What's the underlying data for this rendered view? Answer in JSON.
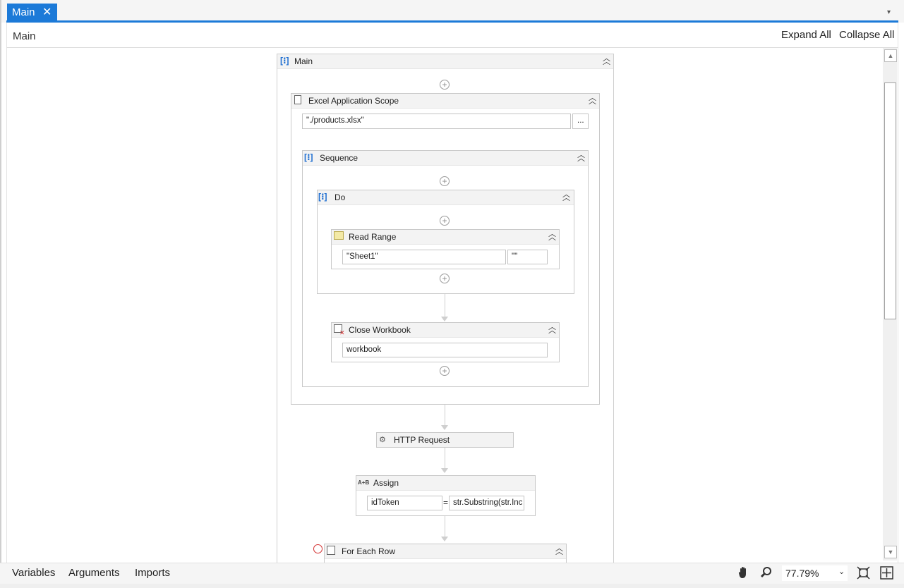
{
  "tab": {
    "label": "Main",
    "close": "✕"
  },
  "tab_menu": "▾",
  "breadcrumb": "Main",
  "toolbar": {
    "expand_all": "Expand All",
    "collapse_all": "Collapse All"
  },
  "workflow": {
    "main": {
      "title": "Main"
    },
    "excel_scope": {
      "title": "Excel Application Scope",
      "path": "\"./products.xlsx\"",
      "browse": "..."
    },
    "sequence": {
      "title": "Sequence"
    },
    "do": {
      "title": "Do"
    },
    "read_range": {
      "title": "Read Range",
      "sheet": "\"Sheet1\"",
      "range": "\"\""
    },
    "close_workbook": {
      "title": "Close Workbook",
      "workbook": "workbook"
    },
    "http_request": {
      "title": "HTTP Request"
    },
    "assign": {
      "title": "Assign",
      "icon_text": "A+B",
      "to": "idToken",
      "equals": "=",
      "value": "str.Substring(str.Inc"
    },
    "for_each_row": {
      "title": "For Each Row"
    }
  },
  "bottom_tabs": {
    "variables": "Variables",
    "arguments": "Arguments",
    "imports": "Imports"
  },
  "zoom": {
    "value": "77.79%"
  },
  "icons": [
    "hand-pan-icon",
    "zoom-magnifier-icon",
    "fit-to-screen-icon",
    "overview-icon"
  ],
  "colors": {
    "accent": "#1c7ad8",
    "breakpoint": "#d32f2f"
  }
}
